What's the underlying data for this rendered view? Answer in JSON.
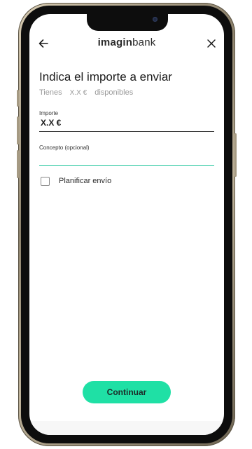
{
  "header": {
    "logo_bold": "imagin",
    "logo_light": "bank"
  },
  "page": {
    "title": "Indica el importe a enviar",
    "available_prefix": "Tienes",
    "available_amount": "X.X €",
    "available_suffix": "disponibles"
  },
  "form": {
    "amount_label": "Importe",
    "amount_value": "X.X €",
    "concept_label": "Concepto (opcional)",
    "concept_value": "",
    "schedule_label": "Planificar envío",
    "schedule_checked": false
  },
  "actions": {
    "continue_label": "Continuar"
  },
  "colors": {
    "accent": "#1fe0a5",
    "focus_line": "#1fc59a",
    "text": "#1a1a1a",
    "muted": "#9a9a9a"
  },
  "icons": {
    "back": "arrow-left-icon",
    "close": "close-icon"
  }
}
